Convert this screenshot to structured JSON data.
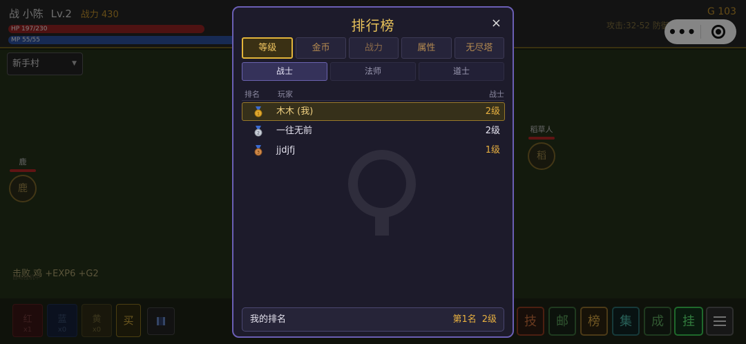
{
  "player": {
    "class_glyph": "战",
    "name": "小陈",
    "level": "Lv.2",
    "power": "战力 430",
    "hp": "HP 197/230",
    "mp": "MP 55/55"
  },
  "top_right": {
    "gold": "G 103",
    "stats": "攻击:32-52 防御:23-36 魔:1-5"
  },
  "map_select": {
    "value": "新手村"
  },
  "monsters": [
    {
      "label": "鹿",
      "icon_text": "鹿"
    },
    {
      "label": "稻草人",
      "icon_text": "稻"
    }
  ],
  "battle_log": {
    "line": "击败 鸡 +EXP6 +G2",
    "sub": "自动挂机中"
  },
  "quick_items": [
    {
      "name": "红",
      "count": "x1"
    },
    {
      "name": "蓝",
      "count": "x0"
    },
    {
      "name": "黄",
      "count": "x0"
    }
  ],
  "buy_label": "买",
  "function_buttons": [
    "技",
    "邮",
    "榜",
    "集",
    "成",
    "挂"
  ],
  "leaderboard": {
    "title": "排行榜",
    "close": "×",
    "categories": [
      "等级",
      "金币",
      "战力",
      "属性",
      "无尽塔"
    ],
    "active_category": "等级",
    "classes": [
      "战士",
      "法师",
      "道士"
    ],
    "active_class": "战士",
    "headers": {
      "rank": "排名",
      "player": "玩家",
      "value": "战士"
    },
    "rows": [
      {
        "medal": "gold-medal-icon",
        "name": "木木 (我)",
        "value": "2级",
        "is_me": true
      },
      {
        "medal": "silver-medal-icon",
        "name": "一往无前",
        "value": "2级",
        "is_me": false
      },
      {
        "medal": "bronze-medal-icon",
        "name": "jjdjfj",
        "value": "1级",
        "is_me": false
      }
    ],
    "my_rank": {
      "label": "我的排名",
      "rank": "第1名",
      "value": "2级"
    }
  },
  "colors": {
    "accent_gold": "#e8b040",
    "modal_border": "#6b5fb5",
    "hp": "#8e2222",
    "mp": "#2b4e9a"
  }
}
